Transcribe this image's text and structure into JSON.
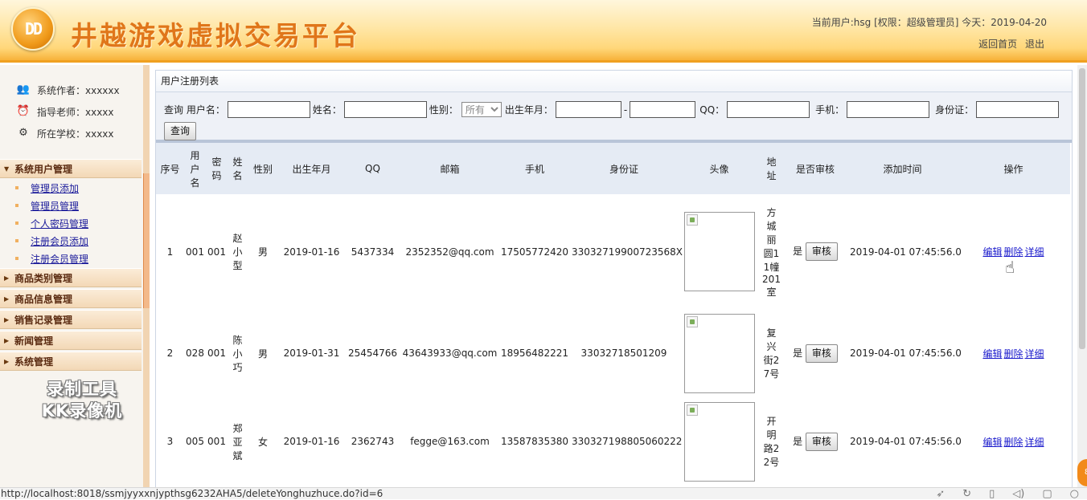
{
  "header": {
    "logo_text": "DD",
    "app_title": "井越游戏虚拟交易平台",
    "user_info": "当前用户:hsg [权限：超级管理员] 今天：2019-04-20",
    "links": [
      "返回首页",
      "退出"
    ]
  },
  "sidebar": {
    "info": [
      {
        "icon": "author-icon",
        "text": "系统作者：xxxxxx"
      },
      {
        "icon": "teacher-icon",
        "text": "指导老师：xxxxx"
      },
      {
        "icon": "school-icon",
        "text": "所在学校：xxxxx"
      }
    ],
    "groups": [
      {
        "label": "系统用户管理",
        "items": [
          "管理员添加",
          "管理员管理",
          "个人密码管理",
          "注册会员添加",
          "注册会员管理"
        ]
      },
      {
        "label": "商品类别管理"
      },
      {
        "label": "商品信息管理"
      },
      {
        "label": "销售记录管理"
      },
      {
        "label": "新闻管理"
      },
      {
        "label": "系统管理"
      }
    ],
    "watermark": [
      "录制工具",
      "KK录像机"
    ]
  },
  "panel": {
    "title": "用户注册列表"
  },
  "search": {
    "prefix": "查询",
    "username_label": "用户名：",
    "name_label": "姓名：",
    "gender_label": "性别：",
    "gender_value": "所有",
    "birth_label": "出生年月：",
    "birth_sep": "-",
    "qq_label": "QQ：",
    "phone_label": "手机：",
    "id_label": "身份证：",
    "button": "查询"
  },
  "table": {
    "columns": [
      "序号",
      "用户名",
      "密码",
      "姓名",
      "性别",
      "出生年月",
      "QQ",
      "邮箱",
      "手机",
      "身份证",
      "头像",
      "地址",
      "是否审核",
      "添加时间",
      "操作"
    ],
    "rows": [
      {
        "no": "1",
        "username": "001",
        "password": "001",
        "name": "赵小型",
        "gender": "男",
        "birth": "2019-01-16",
        "qq": "5437334",
        "email": "2352352@qq.com",
        "phone": "17505772420",
        "idcard": "33032719900723568X",
        "address": "方城丽圆11幢201室",
        "approved": "是",
        "time": "2019-04-01 07:45:56.0"
      },
      {
        "no": "2",
        "username": "028",
        "password": "001",
        "name": "陈小巧",
        "gender": "男",
        "birth": "2019-01-31",
        "qq": "25454766",
        "email": "43643933@qq.com",
        "phone": "18956482221",
        "idcard": "33032718501209",
        "address": "复兴街27号",
        "approved": "是",
        "time": "2019-04-01 07:45:56.0"
      },
      {
        "no": "3",
        "username": "005",
        "password": "001",
        "name": "郑亚斌",
        "gender": "女",
        "birth": "2019-01-16",
        "qq": "2362743",
        "email": "fegge@163.com",
        "phone": "13587835380",
        "idcard": "330327198805060222",
        "address": "开明路22号",
        "approved": "是",
        "time": "2019-04-01 07:45:56.0"
      }
    ],
    "audit_button": "审核",
    "ops": [
      "编辑",
      "删除",
      "详细"
    ]
  },
  "statusbar": {
    "url": "http://localhost:8018/ssmjyyxxnjypthsg6232AHA5/deleteYonghuzhuce.do?id=6",
    "icons": [
      "rocket-icon",
      "refresh-icon",
      "trash-icon",
      "sound-icon",
      "window-icon",
      "zoom-icon"
    ]
  },
  "corner_badge": "8"
}
